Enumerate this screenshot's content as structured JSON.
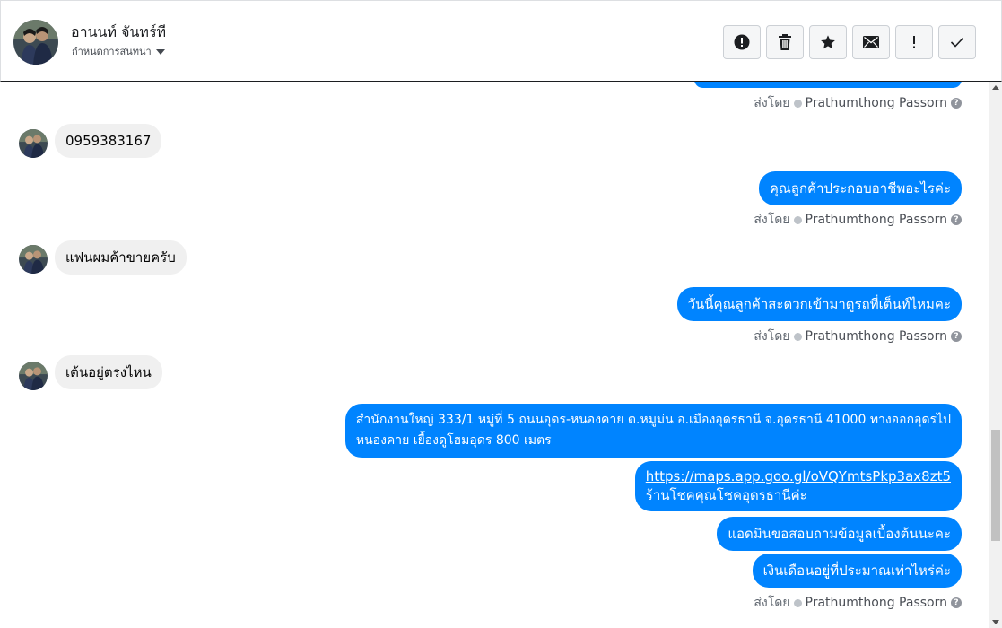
{
  "header": {
    "contact_name": "อานนท์ จันทร์ที",
    "subtitle": "กำหนดการสนทนา"
  },
  "toolbar": {
    "buttons": [
      {
        "icon": "alert-circle-icon"
      },
      {
        "icon": "trash-icon"
      },
      {
        "icon": "star-icon"
      },
      {
        "icon": "envelope-icon"
      },
      {
        "icon": "exclamation-icon"
      },
      {
        "icon": "check-icon"
      }
    ]
  },
  "thread": {
    "sent_by_label": "ส่งโดย",
    "agent_name": "Prathumthong Passorn",
    "messages": [
      {
        "id": "in1",
        "text": "0959383167"
      },
      {
        "id": "out1",
        "text": "คุณลูกค้าประกอบอาชีพอะไรค่ะ"
      },
      {
        "id": "in2",
        "text": "แฟนผมค้าขายครับ"
      },
      {
        "id": "out2",
        "text": "วันนี้คุณลูกค้าสะดวกเข้ามาดูรถที่เต็นท์ไหมคะ"
      },
      {
        "id": "in3",
        "text": "เต้นอยู่ตรงไหน"
      },
      {
        "id": "out3_line1",
        "text": "สำนักงานใหญ่ 333/1 หมู่ที่ 5 ถนนอุดร-หนองคาย ต.หมูม่น อ.เมืองอุดรธานี จ.อุดรธานี 41000 ทางออกอุดรไป"
      },
      {
        "id": "out3_line2",
        "text": "หนองคาย เยื้องดูโฮมอุดร 800 เมตร"
      },
      {
        "id": "out4_link",
        "text": "https://maps.app.goo.gl/oVQYmtsPkp3ax8zt5"
      },
      {
        "id": "out4_line2",
        "text": "ร้านโชคคุณโชคอุดรธานีค่ะ"
      },
      {
        "id": "out5",
        "text": "แอดมินขอสอบถามข้อมูลเบื้องต้นนะคะ"
      },
      {
        "id": "out6",
        "text": "เงินเดือนอยู่ที่ประมาณเท่าไหร่ค่ะ"
      }
    ]
  },
  "colors": {
    "outgoing_bubble": "#0084ff",
    "incoming_bubble": "#f0f0f0",
    "meta_text": "#606770"
  }
}
